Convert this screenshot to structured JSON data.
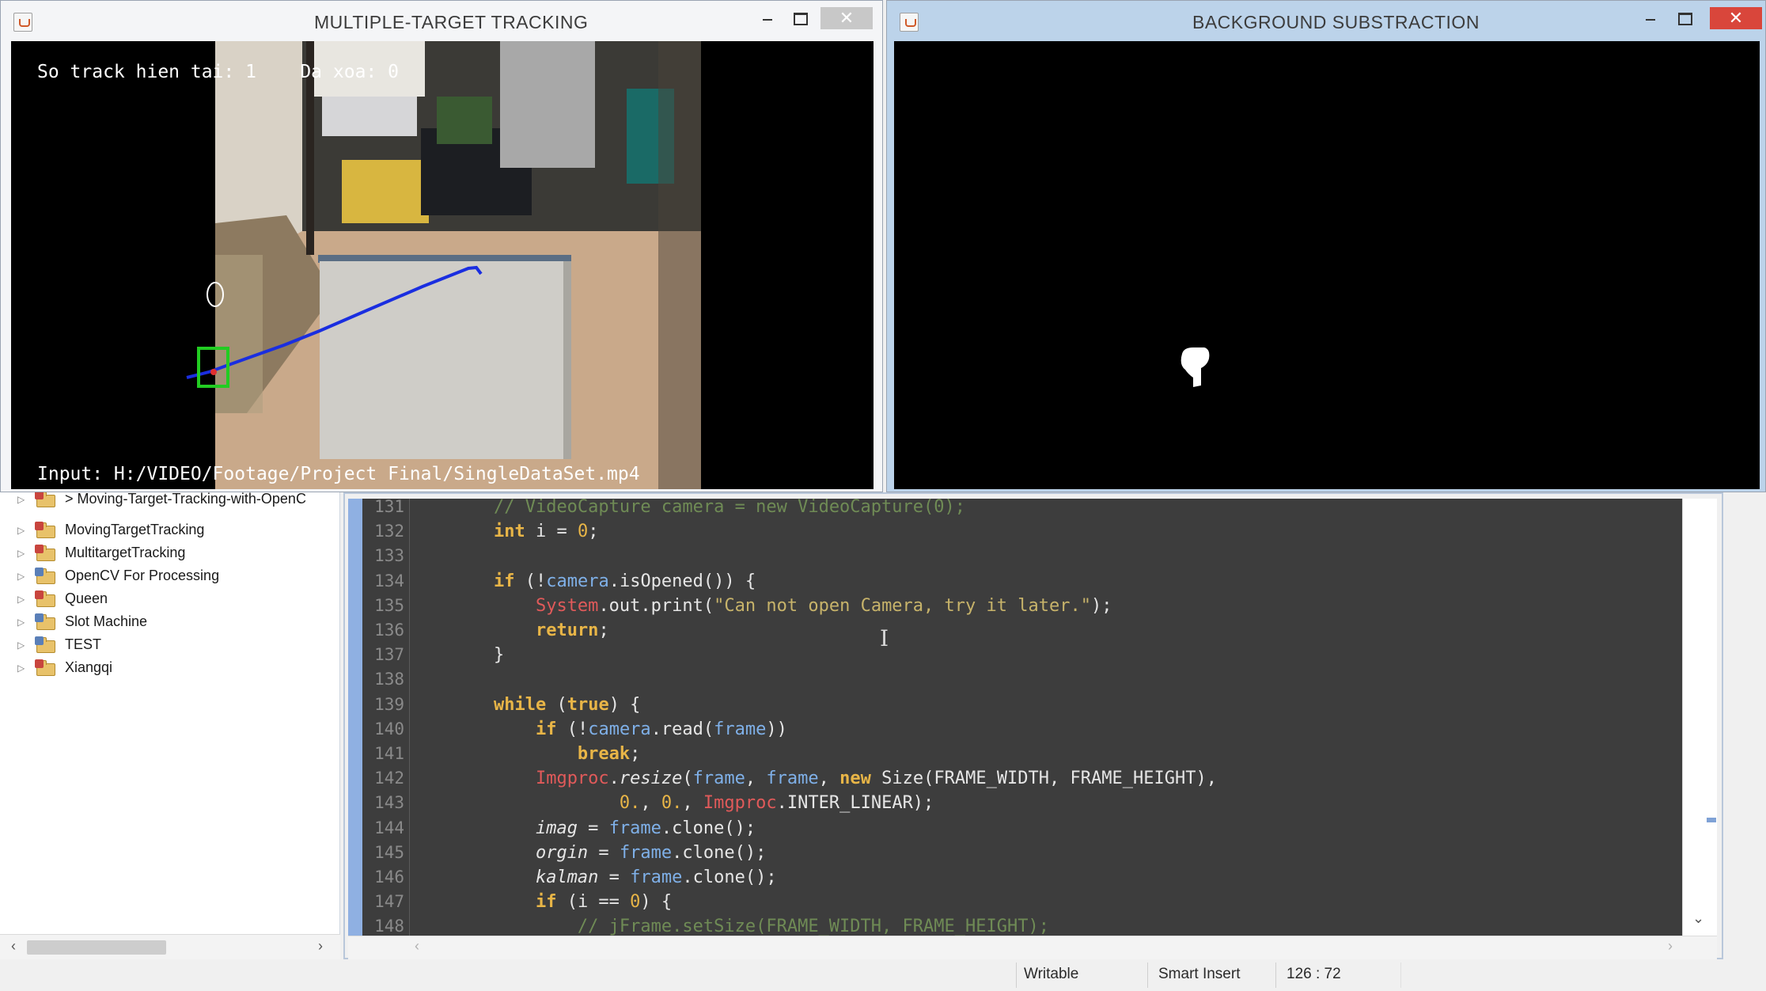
{
  "tracking_window": {
    "title": "MULTIPLE-TARGET TRACKING",
    "overlay_top": "So track hien tai: 1    Da xoa: 0",
    "overlay_bottom": "Input: H:/VIDEO/Footage/Project Final/SingleDataSet.mp4"
  },
  "background_window": {
    "title": "BACKGROUND SUBSTRACTION"
  },
  "explorer": {
    "items": [
      {
        "label": "> Moving-Target-Tracking-with-OpenC",
        "icon": "java-project-icon"
      },
      {
        "label": "MovingTargetTracking",
        "icon": "java-project-icon"
      },
      {
        "label": "MultitargetTracking",
        "icon": "java-project-icon"
      },
      {
        "label": "OpenCV For Processing",
        "icon": "project-folder-icon"
      },
      {
        "label": "Queen",
        "icon": "java-project-icon"
      },
      {
        "label": "Slot Machine",
        "icon": "project-folder-icon"
      },
      {
        "label": "TEST",
        "icon": "project-folder-icon"
      },
      {
        "label": "Xiangqi",
        "icon": "java-project-icon"
      }
    ]
  },
  "editor": {
    "lines": [
      {
        "num": "131",
        "tokens": [
          [
            "        ",
            ""
          ],
          [
            "// VideoCapture camera = new VideoCapture(0);",
            "comment"
          ]
        ]
      },
      {
        "num": "132",
        "tokens": [
          [
            "        ",
            ""
          ],
          [
            "int",
            "kw"
          ],
          [
            " i = ",
            ""
          ],
          [
            "0",
            "num"
          ],
          [
            ";",
            ""
          ]
        ]
      },
      {
        "num": "133",
        "tokens": []
      },
      {
        "num": "134",
        "tokens": [
          [
            "        ",
            ""
          ],
          [
            "if",
            "kw"
          ],
          [
            " (!",
            ""
          ],
          [
            "camera",
            "field"
          ],
          [
            ".isOpened()) {",
            ""
          ]
        ]
      },
      {
        "num": "135",
        "tokens": [
          [
            "            ",
            ""
          ],
          [
            "System",
            "cls"
          ],
          [
            ".out.print(",
            ""
          ],
          [
            "\"Can not open Camera, try it later.\"",
            "str"
          ],
          [
            ");",
            ""
          ]
        ]
      },
      {
        "num": "136",
        "tokens": [
          [
            "            ",
            ""
          ],
          [
            "return",
            "kw"
          ],
          [
            ";",
            ""
          ]
        ]
      },
      {
        "num": "137",
        "tokens": [
          [
            "        }",
            ""
          ]
        ]
      },
      {
        "num": "138",
        "tokens": []
      },
      {
        "num": "139",
        "tokens": [
          [
            "        ",
            ""
          ],
          [
            "while",
            "kw"
          ],
          [
            " (",
            ""
          ],
          [
            "true",
            "kw"
          ],
          [
            ") {",
            ""
          ]
        ]
      },
      {
        "num": "140",
        "tokens": [
          [
            "            ",
            ""
          ],
          [
            "if",
            "kw"
          ],
          [
            " (!",
            ""
          ],
          [
            "camera",
            "field"
          ],
          [
            ".read(",
            ""
          ],
          [
            "frame",
            "field"
          ],
          [
            "))",
            ""
          ]
        ]
      },
      {
        "num": "141",
        "tokens": [
          [
            "                ",
            ""
          ],
          [
            "break",
            "kw"
          ],
          [
            ";",
            ""
          ]
        ]
      },
      {
        "num": "142",
        "tokens": [
          [
            "            ",
            ""
          ],
          [
            "Imgproc",
            "cls"
          ],
          [
            ".",
            ""
          ],
          [
            "resize",
            "ital"
          ],
          [
            "(",
            ""
          ],
          [
            "frame",
            "field"
          ],
          [
            ", ",
            ""
          ],
          [
            "frame",
            "field"
          ],
          [
            ", ",
            ""
          ],
          [
            "new",
            "kw"
          ],
          [
            " Size(FRAME_WIDTH, FRAME_HEIGHT),",
            ""
          ]
        ]
      },
      {
        "num": "143",
        "tokens": [
          [
            "                    ",
            ""
          ],
          [
            "0.",
            "num"
          ],
          [
            ", ",
            ""
          ],
          [
            "0.",
            "num"
          ],
          [
            ", ",
            ""
          ],
          [
            "Imgproc",
            "cls"
          ],
          [
            ".INTER_LINEAR);",
            ""
          ]
        ]
      },
      {
        "num": "144",
        "tokens": [
          [
            "            ",
            ""
          ],
          [
            "imag",
            "ital"
          ],
          [
            " = ",
            ""
          ],
          [
            "frame",
            "field"
          ],
          [
            ".clone();",
            ""
          ]
        ]
      },
      {
        "num": "145",
        "tokens": [
          [
            "            ",
            ""
          ],
          [
            "orgin",
            "ital"
          ],
          [
            " = ",
            ""
          ],
          [
            "frame",
            "field"
          ],
          [
            ".clone();",
            ""
          ]
        ]
      },
      {
        "num": "146",
        "tokens": [
          [
            "            ",
            ""
          ],
          [
            "kalman",
            "ital"
          ],
          [
            " = ",
            ""
          ],
          [
            "frame",
            "field"
          ],
          [
            ".clone();",
            ""
          ]
        ]
      },
      {
        "num": "147",
        "tokens": [
          [
            "            ",
            ""
          ],
          [
            "if",
            "kw"
          ],
          [
            " (i == ",
            ""
          ],
          [
            "0",
            "num"
          ],
          [
            ") {",
            ""
          ]
        ]
      },
      {
        "num": "148",
        "tokens": [
          [
            "                ",
            ""
          ],
          [
            "// jFrame.setSize(FRAME_WIDTH, FRAME_HEIGHT);",
            "comment"
          ]
        ]
      }
    ],
    "syntax_colors": {
      "comment": "#6f8b55",
      "kw": "#e8b547",
      "num": "#e8b547",
      "field": "#7fb0e8",
      "cls": "#e05a5a",
      "str": "#c7b36a",
      "ital": "#e6e6e6"
    }
  },
  "statusbar": {
    "writable": "Writable",
    "insert_mode": "Smart Insert",
    "position": "126 : 72"
  }
}
